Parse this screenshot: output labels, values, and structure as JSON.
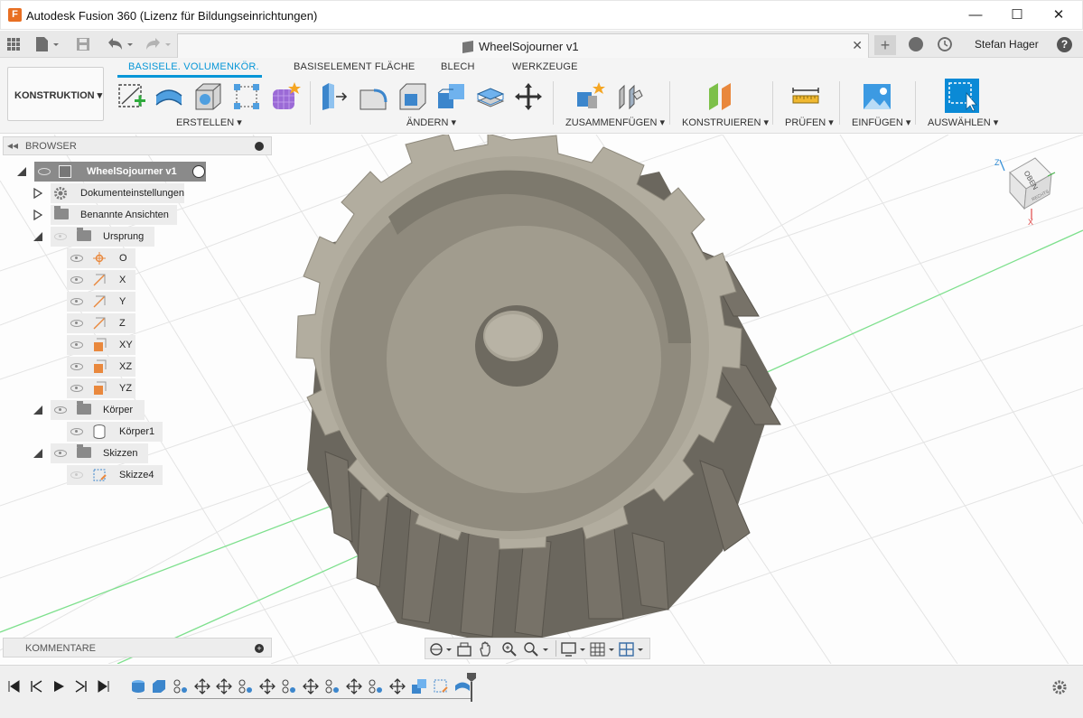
{
  "window": {
    "title": "Autodesk Fusion 360 (Lizenz für Bildungseinrichtungen)",
    "logo_letter": "F"
  },
  "doc_tab": {
    "title": "WheelSojourner v1",
    "close_label": "✕"
  },
  "user": {
    "name": "Stefan Hager"
  },
  "help_label": "?",
  "workspace": {
    "label": "KONSTRUKTION"
  },
  "ribbon_tabs": [
    "BASISELE. VOLUMENKÖR.",
    "BASISELEMENT FLÄCHE",
    "BLECH",
    "WERKZEUGE"
  ],
  "active_tab_index": 0,
  "groups": [
    "ERSTELLEN",
    "ÄNDERN",
    "ZUSAMMENFÜGEN",
    "KONSTRUIEREN",
    "PRÜFEN",
    "EINFÜGEN",
    "AUSWÄHLEN"
  ],
  "browser": {
    "title": "BROWSER",
    "root": "WheelSojourner v1",
    "items": {
      "doc_settings": "Dokumenteinstellungen",
      "named_views": "Benannte Ansichten",
      "origin": "Ursprung",
      "o": "O",
      "x": "X",
      "y": "Y",
      "z": "Z",
      "xy": "XY",
      "xz": "XZ",
      "yz": "YZ",
      "bodies": "Körper",
      "body1": "Körper1",
      "sketches": "Skizzen",
      "sketch4": "Skizze4"
    }
  },
  "comments": {
    "title": "KOMMENTARE"
  },
  "viewcube": {
    "face": "OBEN",
    "side": "RECHTS",
    "axis_z": "Z",
    "axis_x": "X"
  },
  "colors": {
    "accent": "#0696d7",
    "model": "#8a8579",
    "model_light": "#b5b0a3",
    "model_dark": "#6a665d",
    "grid": "#e2e2e2",
    "axis_green": "#2fd14a"
  }
}
